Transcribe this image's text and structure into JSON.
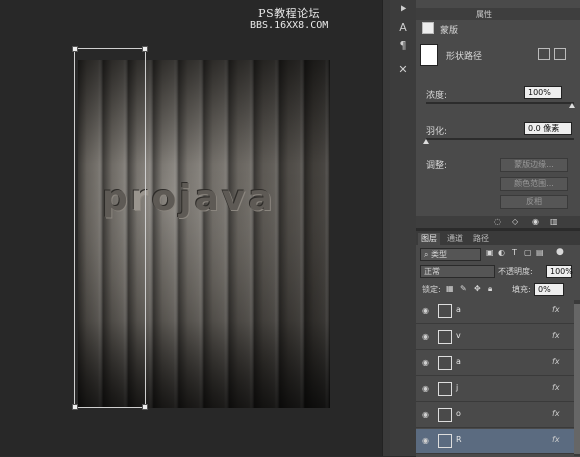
{
  "watermark": {
    "line1": "PS教程论坛",
    "line2": "BBS.16XX8.COM"
  },
  "canvas": {
    "letters": [
      "p",
      "r",
      "o",
      "j",
      "a",
      "v",
      "a"
    ]
  },
  "properties": {
    "panel_title": "属性",
    "mask_label": "蒙版",
    "shape_path_label": "形状路径",
    "density_label": "浓度:",
    "density_value": "100%",
    "density_level": 1.0,
    "feather_label": "羽化:",
    "feather_value": "0.0 像素",
    "feather_level": 0.0,
    "adjust_label": "调整:",
    "buttons": [
      "蒙版边缘...",
      "颜色范围...",
      "反相"
    ]
  },
  "layers": {
    "tabs": [
      "图层",
      "通道",
      "路径"
    ],
    "filter_kind": "类型",
    "blend_mode": "正常",
    "opacity_label": "不透明度:",
    "opacity_value": "100%",
    "lock_label": "锁定:",
    "fill_label": "填充:",
    "fill_value": "0%",
    "items": [
      {
        "name": "a",
        "fx": "fx"
      },
      {
        "name": "v",
        "fx": "fx"
      },
      {
        "name": "a",
        "fx": "fx"
      },
      {
        "name": "j",
        "fx": "fx"
      },
      {
        "name": "o",
        "fx": "fx"
      },
      {
        "name": "R",
        "fx": "fx",
        "selected": true
      }
    ]
  },
  "colors": {
    "selection_blue": "#5b6b80",
    "panel_bg": "#4a4a4a"
  },
  "icons": [
    "arrow-tool-icon",
    "text-tool-icon",
    "paragraph-icon",
    "tools-icon"
  ]
}
